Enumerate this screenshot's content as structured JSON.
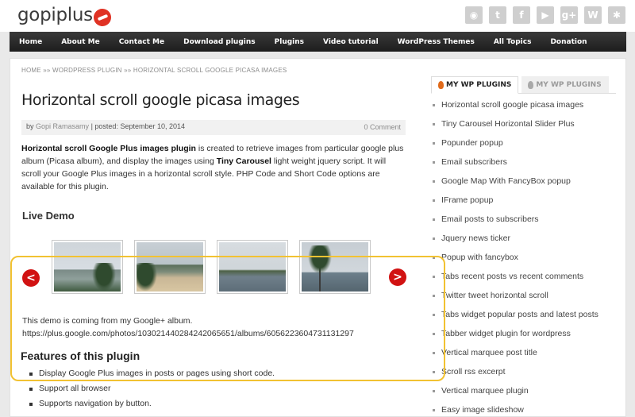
{
  "header": {
    "logo_text": "gopiplus",
    "social_icons": [
      {
        "icon": "rss-icon",
        "glyph": "◉"
      },
      {
        "icon": "twitter-icon",
        "glyph": "t"
      },
      {
        "icon": "facebook-icon",
        "glyph": "f"
      },
      {
        "icon": "youtube-icon",
        "glyph": "▶"
      },
      {
        "icon": "google-plus-icon",
        "glyph": "g+"
      },
      {
        "icon": "wordpress-icon",
        "glyph": "W"
      },
      {
        "icon": "joomla-icon",
        "glyph": "✱"
      }
    ]
  },
  "nav": {
    "items": [
      "Home",
      "About Me",
      "Contact Me",
      "Download plugins",
      "Plugins",
      "Video tutorial",
      "WordPress Themes",
      "All Topics",
      "Donation"
    ]
  },
  "breadcrumb": {
    "home": "Home",
    "sep": "»»",
    "section": "WordPress Plugin",
    "current": "Horizontal scroll google picasa images"
  },
  "post": {
    "title": "Horizontal scroll google picasa images",
    "by_label": "by",
    "author": "Gopi Ramasamy",
    "posted_label": "| posted: September 10, 2014",
    "comments": "0 Comment",
    "intro_bold_1": "Horizontal scroll Google Plus images plugin",
    "intro_text_1": " is created to retrieve images from particular google plus album (Picasa album), and display the images using ",
    "intro_bold_2": "Tiny Carousel",
    "intro_text_2": " light weight jquery script. It will scroll your Google Plus images in a horizontal scroll style. PHP Code and Short Code options are available for this plugin."
  },
  "demo": {
    "title": "Live Demo",
    "prev_glyph": "<",
    "next_glyph": ">",
    "source_line_1": "This demo is coming from my Google+ album.",
    "source_line_2": "https://plus.google.com/photos/103021440284242065651/albums/6056223604731131297"
  },
  "features": {
    "title": "Features of this plugin",
    "items": [
      "Display Google Plus images in posts or pages using short code.",
      "Support all browser",
      "Supports navigation by button."
    ]
  },
  "sidebar": {
    "tab_active": "MY WP PLUGINS",
    "tab_inactive": "MY WP PLUGINS",
    "plugins": [
      "Horizontal scroll google picasa images",
      "Tiny Carousel Horizontal Slider Plus",
      "Popunder popup",
      "Email subscribers",
      "Google Map With FancyBox popup",
      "IFrame popup",
      "Email posts to subscribers",
      "Jquery news ticker",
      "Popup with fancybox",
      "Tabs recent posts vs recent comments",
      "Twitter tweet horizontal scroll",
      "Tabs widget popular posts and latest posts",
      "Tabber widget plugin for wordpress",
      "Vertical marquee post title",
      "Scroll rss excerpt",
      "Vertical marquee plugin",
      "Easy image slideshow"
    ]
  },
  "colors": {
    "accent_red": "#d11212",
    "highlight": "#f2c232",
    "nav_bg": "#1d1d1d"
  }
}
